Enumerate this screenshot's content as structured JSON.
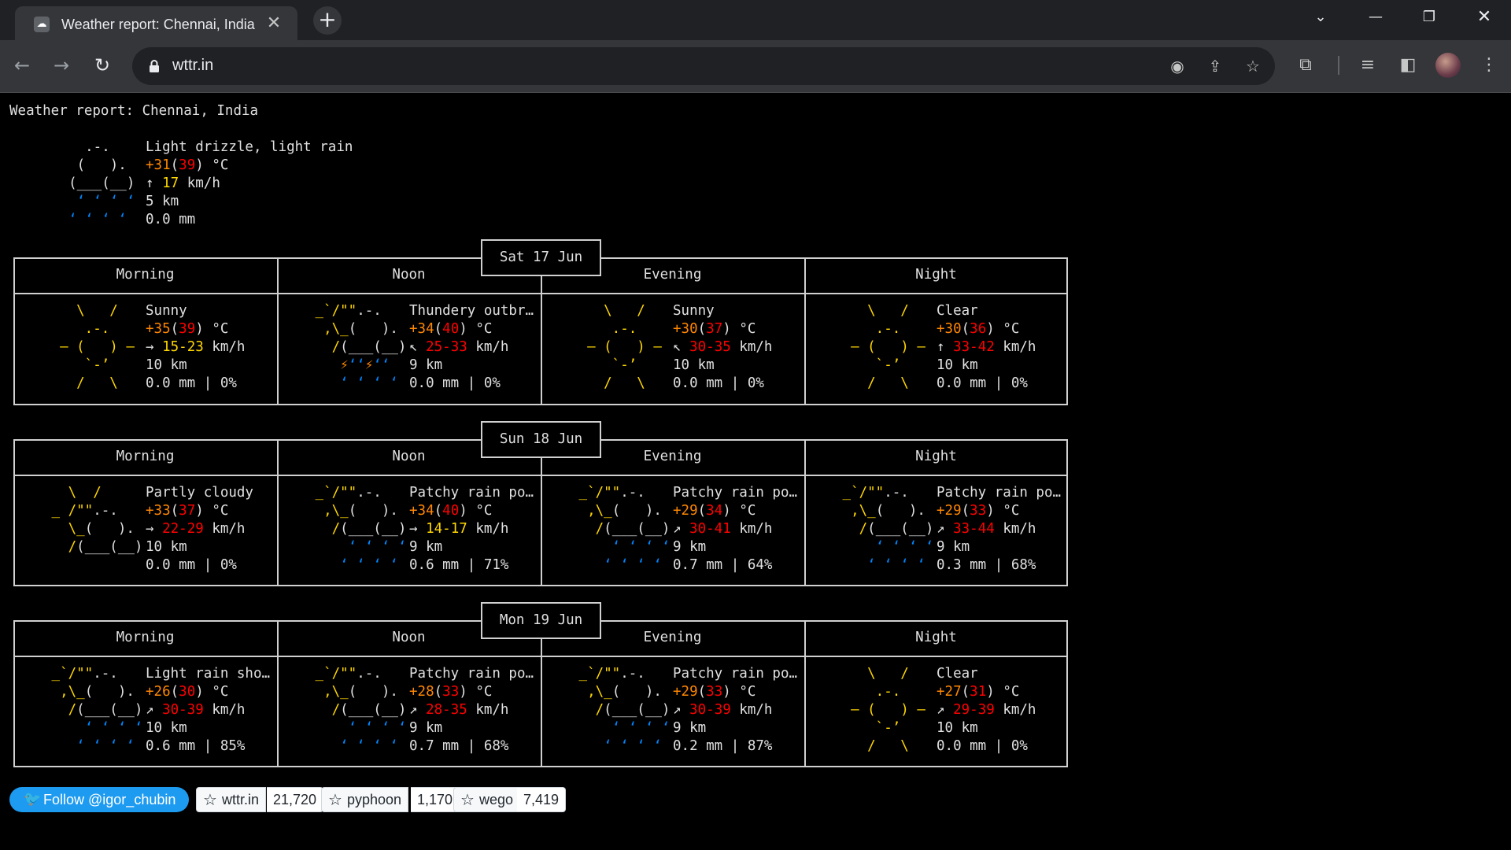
{
  "browser": {
    "tab_title": "Weather report: Chennai, India",
    "url": "wttr.in",
    "favicon": "wttr-favicon-icon"
  },
  "report": {
    "title": "Weather report: Chennai, India",
    "current": {
      "condition": "Light drizzle, light rain",
      "temp": "+31",
      "feels": "39",
      "temp_unit": "°C",
      "wind_dir": "↑",
      "wind": "17",
      "wind_unit": "km/h",
      "visibility": "5 km",
      "precip": "0.0 mm"
    }
  },
  "days": [
    {
      "date": "Sat 17 Jun",
      "periods": [
        {
          "name": "Morning",
          "icon": "sunny",
          "condition": "Sunny",
          "temp": "+35",
          "feels": "39",
          "wind_dir": "→",
          "wind": "15-23",
          "visibility": "10 km",
          "precip": "0.0 mm | 0%"
        },
        {
          "name": "Noon",
          "icon": "thundery",
          "condition": "Thundery outbr…",
          "temp": "+34",
          "feels": "40",
          "wind_dir": "↖",
          "wind": "25-33",
          "visibility": "9 km",
          "precip": "0.0 mm | 0%"
        },
        {
          "name": "Evening",
          "icon": "sunny",
          "condition": "Sunny",
          "temp": "+30",
          "feels": "37",
          "wind_dir": "↖",
          "wind": "30-35",
          "visibility": "10 km",
          "precip": "0.0 mm | 0%"
        },
        {
          "name": "Night",
          "icon": "sunny",
          "condition": "Clear",
          "temp": "+30",
          "feels": "36",
          "wind_dir": "↑",
          "wind": "33-42",
          "visibility": "10 km",
          "precip": "0.0 mm | 0%"
        }
      ]
    },
    {
      "date": "Sun 18 Jun",
      "periods": [
        {
          "name": "Morning",
          "icon": "partly-cloudy",
          "condition": "Partly cloudy",
          "temp": "+33",
          "feels": "37",
          "wind_dir": "→",
          "wind": "22-29",
          "visibility": "10 km",
          "precip": "0.0 mm | 0%"
        },
        {
          "name": "Noon",
          "icon": "rain",
          "condition": "Patchy rain po…",
          "temp": "+34",
          "feels": "40",
          "wind_dir": "→",
          "wind": "14-17",
          "visibility": "9 km",
          "precip": "0.6 mm | 71%"
        },
        {
          "name": "Evening",
          "icon": "rain",
          "condition": "Patchy rain po…",
          "temp": "+29",
          "feels": "34",
          "wind_dir": "↗",
          "wind": "30-41",
          "visibility": "9 km",
          "precip": "0.7 mm | 64%"
        },
        {
          "name": "Night",
          "icon": "rain",
          "condition": "Patchy rain po…",
          "temp": "+29",
          "feels": "33",
          "wind_dir": "↗",
          "wind": "33-44",
          "visibility": "9 km",
          "precip": "0.3 mm | 68%"
        }
      ]
    },
    {
      "date": "Mon 19 Jun",
      "periods": [
        {
          "name": "Morning",
          "icon": "rain",
          "condition": "Light rain sho…",
          "temp": "+26",
          "feels": "30",
          "wind_dir": "↗",
          "wind": "30-39",
          "visibility": "10 km",
          "precip": "0.6 mm | 85%"
        },
        {
          "name": "Noon",
          "icon": "rain",
          "condition": "Patchy rain po…",
          "temp": "+28",
          "feels": "33",
          "wind_dir": "↗",
          "wind": "28-35",
          "visibility": "9 km",
          "precip": "0.7 mm | 68%"
        },
        {
          "name": "Evening",
          "icon": "rain",
          "condition": "Patchy rain po…",
          "temp": "+29",
          "feels": "33",
          "wind_dir": "↗",
          "wind": "30-39",
          "visibility": "9 km",
          "precip": "0.2 mm | 87%"
        },
        {
          "name": "Night",
          "icon": "sunny",
          "condition": "Clear",
          "temp": "+27",
          "feels": "31",
          "wind_dir": "↗",
          "wind": "29-39",
          "visibility": "10 km",
          "precip": "0.0 mm | 0%"
        }
      ]
    }
  ],
  "units": {
    "temp": "°C",
    "wind": "km/h"
  },
  "footer": {
    "twitter_label": "Follow @igor_chubin",
    "repos": [
      {
        "name": "wttr.in",
        "stars": "21,720"
      },
      {
        "name": "pyphoon",
        "stars": "1,170"
      },
      {
        "name": "wego",
        "stars": "7,419"
      }
    ]
  },
  "colors": {
    "yellow": "#ffd700",
    "orange": "#ff8700",
    "red": "#ff0000",
    "rain": "#0087ff",
    "twitter": "#1d9bf0"
  }
}
